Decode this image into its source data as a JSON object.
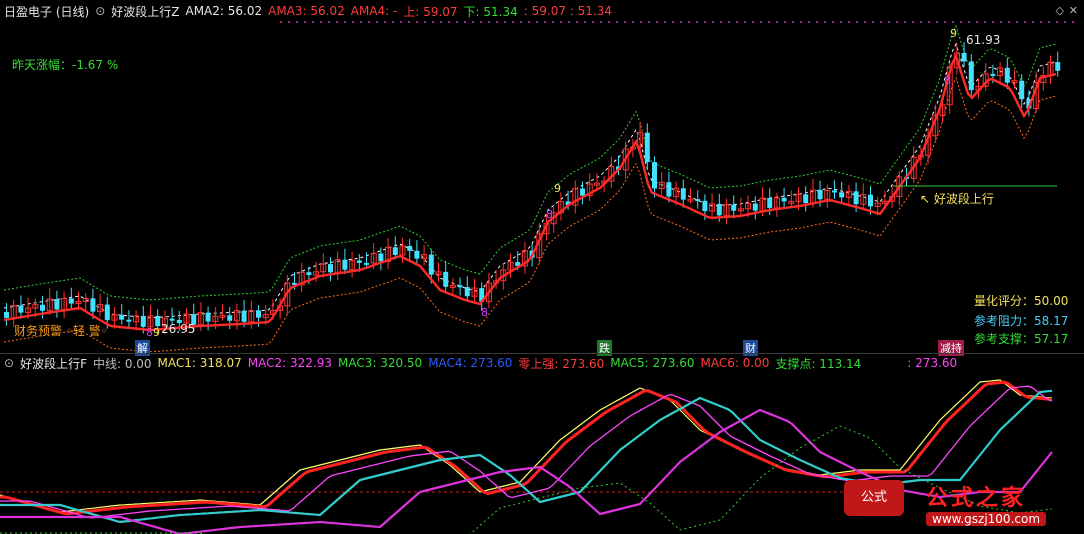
{
  "header": {
    "stock": "日盈电子 (日线)",
    "indicator": "好波段上行Z",
    "ama2": "AMA2: 56.02",
    "ama3": "AMA3: 56.02",
    "ama4": "AMA4: -",
    "up": "上: 59.07",
    "down": "下: 51.34",
    "range": ": 59.07 : 51.34"
  },
  "main_panel": {
    "prev_change": "昨天涨幅：-1.67 %",
    "high_label": "61.93",
    "low_label": "26.95",
    "uptrend_label": "好波段上行",
    "warn_text": "财务预警 ◦轻 警◦",
    "quant_score": "量化评分：50.00",
    "ref_resistance": "参考阻力：58.17",
    "ref_support": "参考支撑：57.17",
    "markers": [
      {
        "text": "8",
        "color": "#cc44ff"
      },
      {
        "text": "9",
        "color": "#f5e05a"
      },
      {
        "text": "9",
        "color": "#f5e05a"
      },
      {
        "text": "8",
        "color": "#cc44ff"
      },
      {
        "text": "8",
        "color": "#cc44ff"
      },
      {
        "text": "9",
        "color": "#f5e05a"
      },
      {
        "text": "8",
        "color": "#cc44ff"
      }
    ],
    "tags": [
      "解",
      "跌",
      "财",
      "减持"
    ]
  },
  "sub_header": {
    "indicator": "好波段上行F",
    "zhongxian": "中线: 0.00",
    "mac1": "MAC1: 318.07",
    "mac2": "MAC2: 322.93",
    "mac3": "MAC3: 320.50",
    "mac4": "MAC4: 273.60",
    "lingshang": "零上强: 273.60",
    "mac5": "MAC5: 273.60",
    "mac6": "MAC6: 0.00",
    "zhicheng": "支撑点: 113.14",
    "tail": ": 273.60"
  },
  "watermark": {
    "text": "公式之家",
    "url": "www.gszj100.com"
  },
  "colors": {
    "up_candle": "#ff3333",
    "down_candle": "#44e0ff",
    "ma_red": "#ff2a2a",
    "upper_band": "#33cc33",
    "lower_band": "#ff6a1a"
  }
}
